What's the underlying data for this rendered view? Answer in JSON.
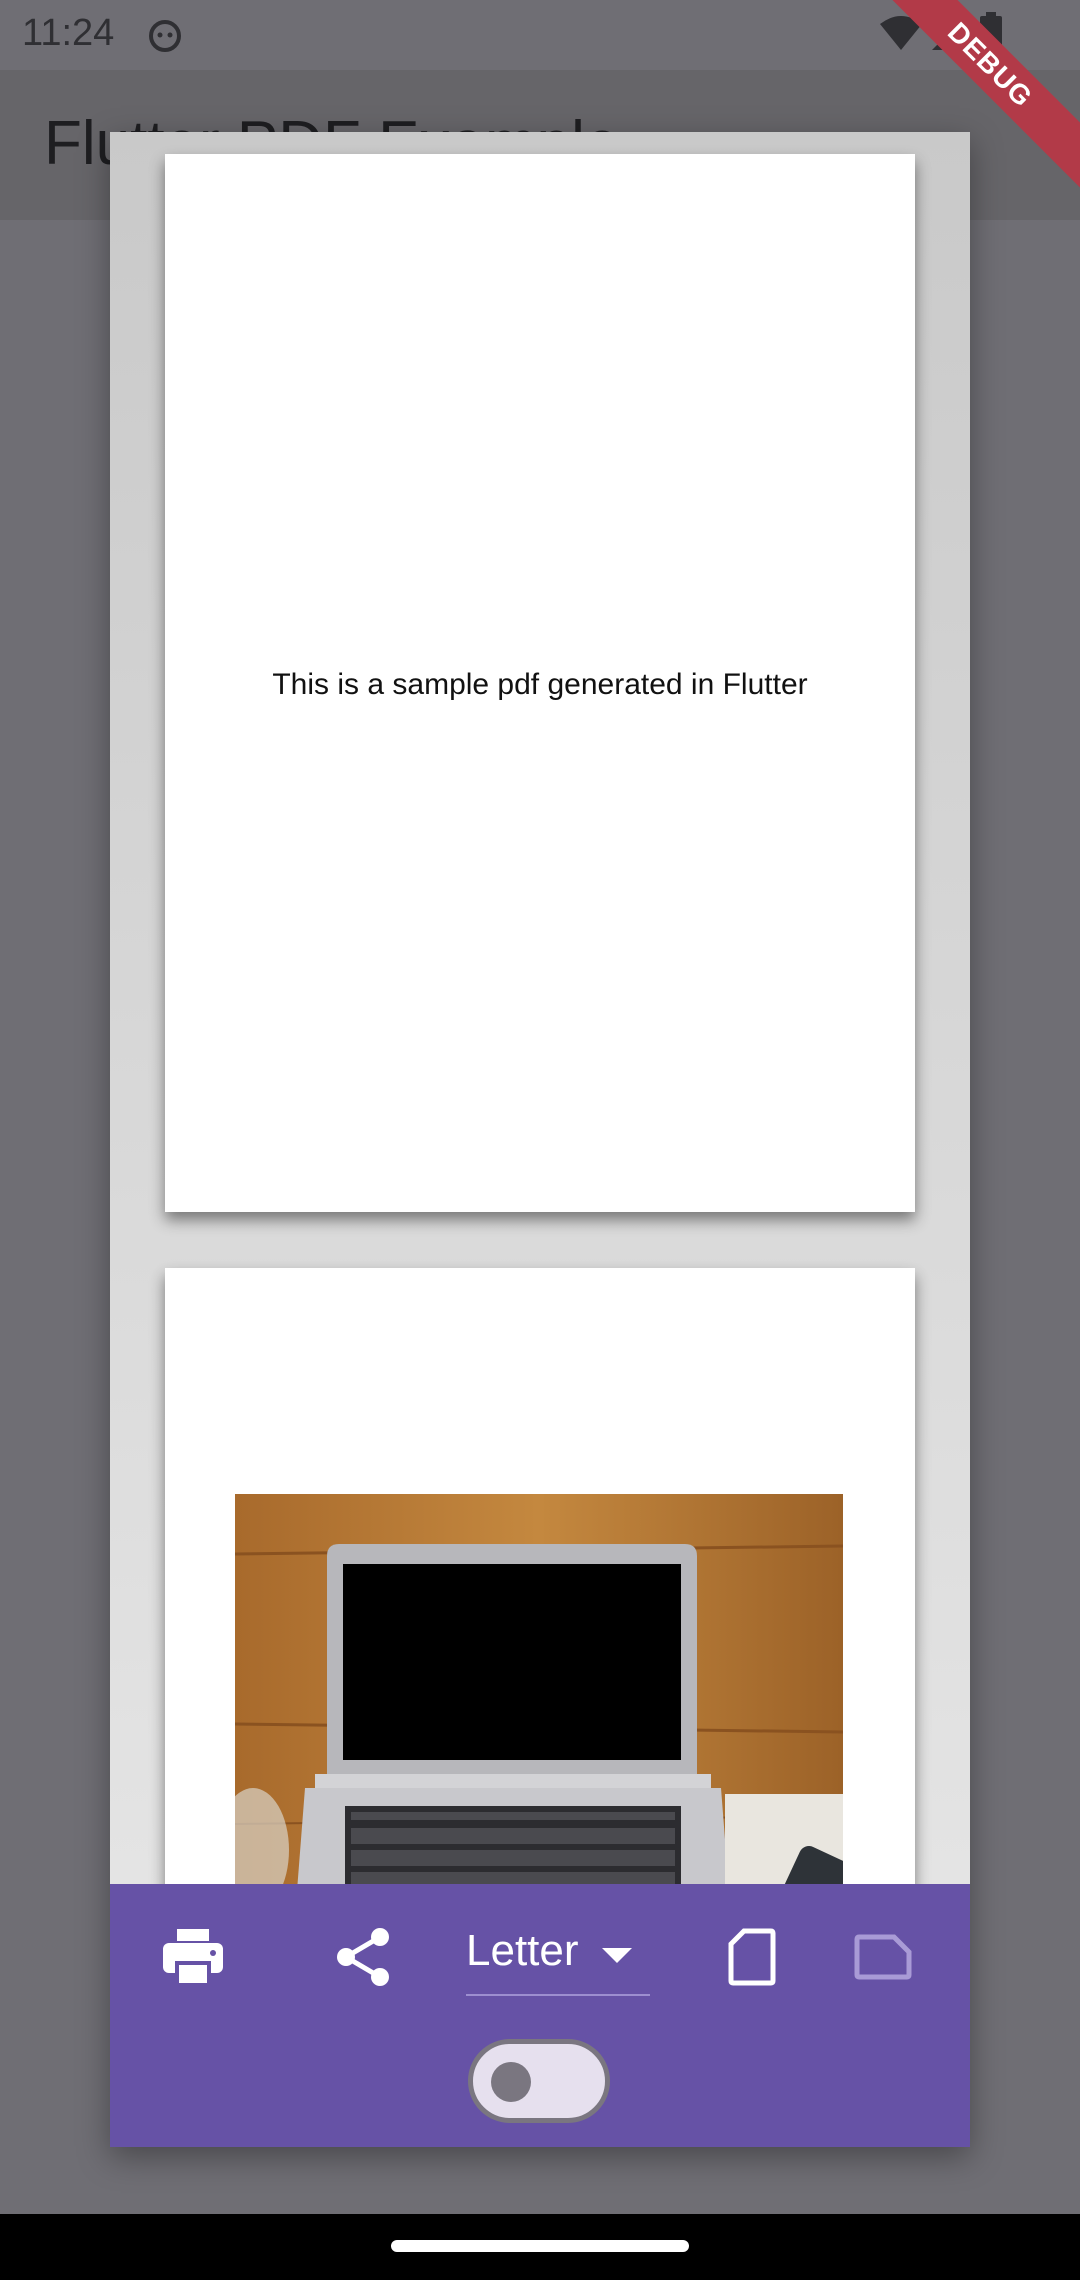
{
  "status_bar": {
    "time": "11:24"
  },
  "app_bar": {
    "title": "Flutter PDF Example"
  },
  "preview": {
    "page1": {
      "text": "This is a sample pdf generated in Flutter"
    }
  },
  "toolbar": {
    "page_format": "Letter",
    "accent_color": "#6652a6"
  },
  "debug_banner": {
    "label": "DEBUG"
  }
}
